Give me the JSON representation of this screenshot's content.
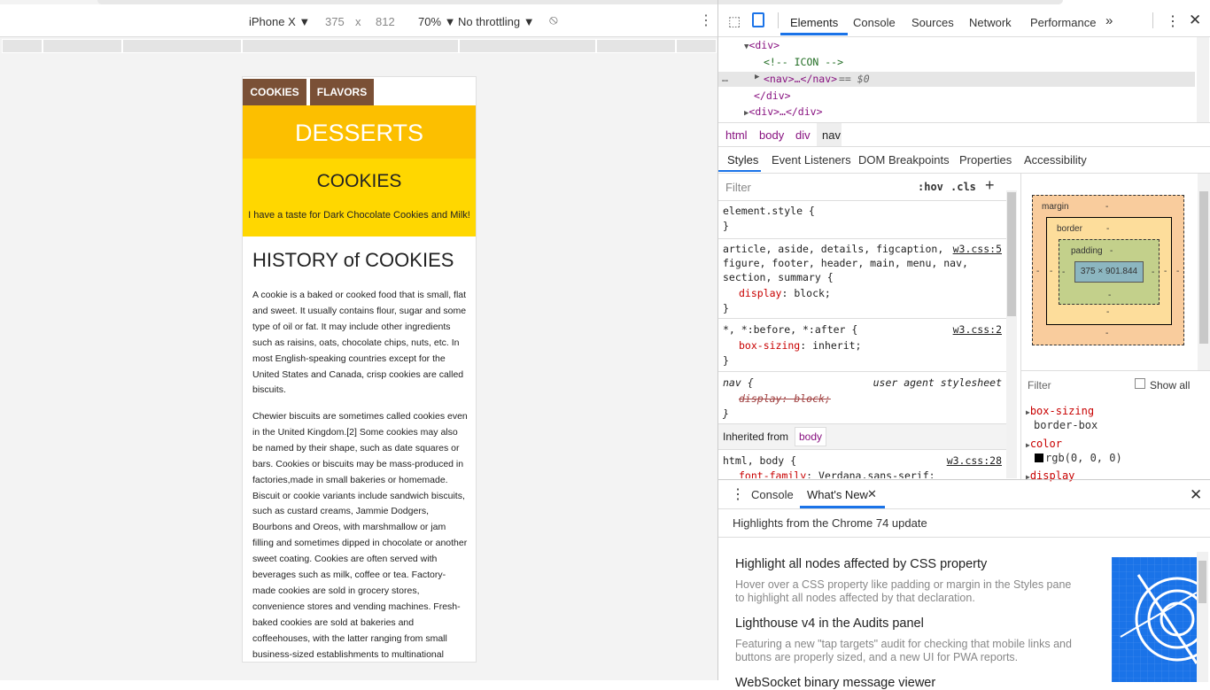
{
  "device_toolbar": {
    "device": "iPhone X",
    "width": "375",
    "times": "x",
    "height": "812",
    "zoom": "70%",
    "throttle": "No throttling"
  },
  "page": {
    "tabs": [
      "COOKIES",
      "FLAVORS"
    ],
    "banner": "DESSERTS",
    "section_title": "COOKIES",
    "tagline": "I have a taste for Dark Chocolate Cookies and Milk!",
    "history_title": "HISTORY of COOKIES",
    "para1": "A cookie is a baked or cooked food that is small, flat and sweet. It usually contains flour, sugar and some type of oil or fat. It may include other ingredients such as raisins, oats, chocolate chips, nuts, etc. In most English-speaking countries except for the United States and Canada, crisp cookies are called biscuits.",
    "para2": "Chewier biscuits are sometimes called cookies even in the United Kingdom.[2] Some cookies may also be named by their shape, such as date squares or bars. Cookies or biscuits may be mass-produced in factories,made in small bakeries or homemade. Biscuit or cookie variants include sandwich biscuits, such as custard creams, Jammie Dodgers, Bourbons and Oreos, with marshmallow or jam filling and sometimes dipped in chocolate or another sweet coating. Cookies are often served with beverages such as milk, coffee or tea. Factory-made cookies are sold in grocery stores, convenience stores and vending machines. Fresh-baked cookies are sold at bakeries and coffeehouses, with the latter ranging from small business-sized establishments to multinational corporations such as Starbucks."
  },
  "devtools": {
    "tabs": [
      "Elements",
      "Console",
      "Sources",
      "Network",
      "Performance",
      "»"
    ],
    "dom": {
      "line1": "<div>",
      "line2": "<!-- ICON -->",
      "line3": "<nav>…</nav>",
      "line3_suffix": "== $0",
      "line4": "</div>",
      "line5": "<div>…</div>"
    },
    "breadcrumbs": [
      "html",
      "body",
      "div",
      "nav"
    ],
    "subtabs": [
      "Styles",
      "Event Listeners",
      "DOM Breakpoints",
      "Properties",
      "Accessibility"
    ],
    "filter_placeholder": "Filter",
    "hov": ":hov",
    "cls": ".cls",
    "plus": "+",
    "rules": {
      "r1_sel": "element.style {",
      "r1_end": "}",
      "r2_sel1": "article, aside, details, figcaption,",
      "r2_sel2": "figure, footer, header, main, menu, nav,",
      "r2_sel3": "section, summary {",
      "r2_src": "w3.css:5",
      "r2_prop": "display",
      "r2_val": ": block;",
      "r2_end": "}",
      "r3_sel": "*, *:before, *:after {",
      "r3_src": "w3.css:2",
      "r3_prop": "box-sizing",
      "r3_val": ": inherit;",
      "r3_end": "}",
      "r4_sel": "nav {",
      "r4_src": "user agent stylesheet",
      "r4_prop": "display: block;",
      "r4_end": "}",
      "inherited": "Inherited from",
      "inherited_el": "body",
      "r5_sel": "html, body {",
      "r5_src": "w3.css:28",
      "r5_prop": "font-family",
      "r5_val": ": Verdana,sans-serif;"
    },
    "boxmodel": {
      "margin": "margin",
      "border": "border",
      "padding": "padding",
      "dash": "-",
      "size": "375 × 901.844"
    },
    "computed": {
      "filter": "Filter",
      "show_all": "Show all",
      "p1": "box-sizing",
      "v1": "border-box",
      "p2": "color",
      "v2": "rgb(0, 0, 0)",
      "p3": "display"
    },
    "drawer": {
      "tabs": [
        "Console",
        "What's New"
      ],
      "headline": "Highlights from the Chrome 74 update",
      "f1_title": "Highlight all nodes affected by CSS property",
      "f1_desc": "Hover over a CSS property like padding or margin in the Styles pane to highlight all nodes affected by that declaration.",
      "f2_title": "Lighthouse v4 in the Audits panel",
      "f2_desc": "Featuring a new \"tap targets\" audit for checking that mobile links and buttons are properly sized, and a new UI for PWA reports.",
      "f3_title": "WebSocket binary message viewer"
    }
  }
}
